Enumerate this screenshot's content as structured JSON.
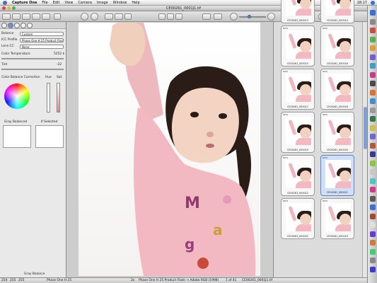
{
  "menubar": {
    "items": [
      "Capture One",
      "File",
      "Edit",
      "View",
      "Camera",
      "Image",
      "Window",
      "Help"
    ],
    "clock": "18:17"
  },
  "window": {
    "title": "CE00261_0001J1.tif"
  },
  "left_panel": {
    "rows": [
      {
        "label": "Balance",
        "value": "Custom"
      },
      {
        "label": "ICC Profile",
        "value": "Phase One H 25 Product Flas"
      },
      {
        "label": "Lens CC",
        "value": "None"
      }
    ],
    "color_temperature": {
      "label": "Color Temperature",
      "value": "5252 k"
    },
    "tint": {
      "label": "Tint",
      "value": "-22"
    },
    "color_balance": {
      "label": "Color Balance Correction",
      "hue": "Hue",
      "sat": "Sat."
    },
    "gray_balance": {
      "left": "Gray Balanced",
      "right": "If Selected"
    },
    "footer_label": "Gray Balance"
  },
  "thumbnails": [
    {
      "caption": "CE00261_000013",
      "badge": "",
      "selected": false
    },
    {
      "caption": "CE00261_000014",
      "badge": "",
      "selected": false
    },
    {
      "caption": "CE00261_000015",
      "badge": "NEW",
      "selected": false
    },
    {
      "caption": "CE00261_000016",
      "badge": "NEW",
      "selected": false
    },
    {
      "caption": "CE00261_000017",
      "badge": "NEW",
      "selected": false
    },
    {
      "caption": "CE00261_000018",
      "badge": "NEW",
      "selected": false
    },
    {
      "caption": "CE00261_000019",
      "badge": "NEW",
      "selected": false
    },
    {
      "caption": "CE00261_000020",
      "badge": "NEW",
      "selected": false
    },
    {
      "caption": "CE00261_000012",
      "badge": "NEW",
      "selected": false
    },
    {
      "caption": "CE00261_000021",
      "badge": "NEW",
      "selected": true
    },
    {
      "caption": "CE00261_000022",
      "badge": "NEW",
      "selected": false
    },
    {
      "caption": "CE00261_000023",
      "badge": "NEW",
      "selected": false
    }
  ],
  "status": {
    "rgb": [
      "254",
      "255",
      "255"
    ],
    "camera": "Phase One H 25",
    "profile": "Phase One H 25 Product Flash → Adobe RGB (1998)",
    "count": "1 of 41",
    "file": "CE00261_0001J1.tif",
    "zoom": "2x"
  },
  "colors": {
    "accent": "#5d83c7",
    "selection": "#cfe0f8"
  }
}
